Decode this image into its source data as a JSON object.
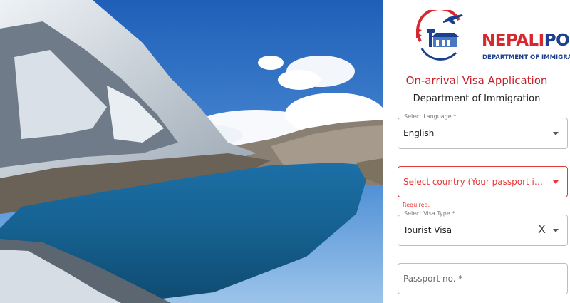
{
  "brand": {
    "name_part1": "NEPALI",
    "name_part2": "PORT",
    "subtitle": "DEPARTMENT OF IMMIGRATION"
  },
  "header": {
    "title": "On-arrival Visa Application",
    "subtitle": "Department of Immigration"
  },
  "form": {
    "language": {
      "label": "Select Language *",
      "value": "English"
    },
    "country": {
      "placeholder": "Select country (Your passport issuing coun...",
      "helper": "Required."
    },
    "visa_type": {
      "label": "Select Visa Type *",
      "value": "Tourist Visa",
      "clear_glyph": "X"
    },
    "passport": {
      "placeholder": "Passport no. *"
    }
  },
  "icons": {
    "dropdown": "chevron-down-icon",
    "clear": "close-icon",
    "logo": "airport-logo-icon"
  },
  "colors": {
    "brand_red": "#d7272f",
    "brand_blue": "#1d3f8f",
    "error": "#e53935",
    "title_red": "#c8202a"
  }
}
